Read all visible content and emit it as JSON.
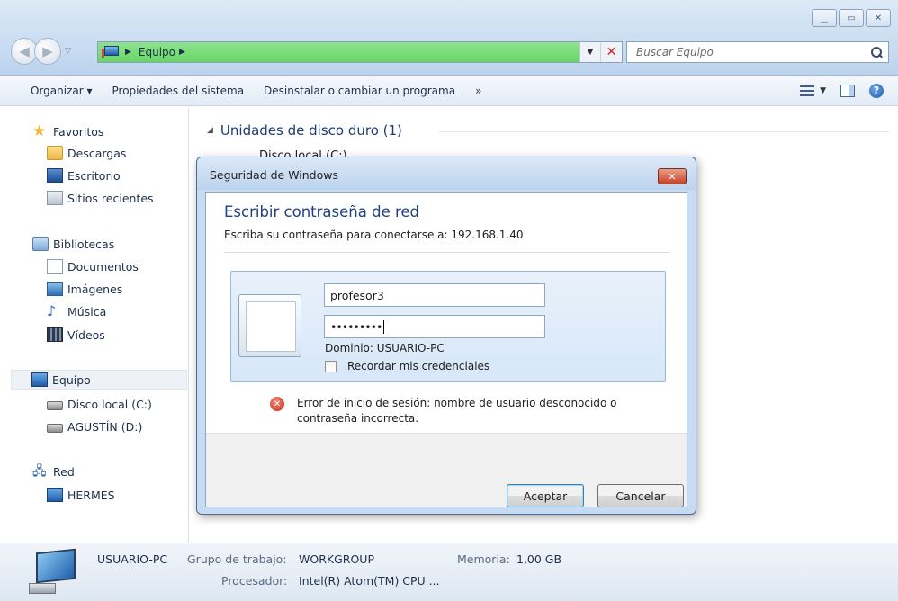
{
  "window": {
    "buttons": [
      "minimize",
      "maximize",
      "close"
    ]
  },
  "address": {
    "location": "Equipo",
    "search_placeholder": "Buscar Equipo"
  },
  "toolbar": {
    "organize": "Organizar ▾",
    "system_props": "Propiedades del sistema",
    "uninstall": "Desinstalar o cambiar un programa",
    "more": "»"
  },
  "sidebar": {
    "favorites": "Favoritos",
    "downloads": "Descargas",
    "desktop": "Escritorio",
    "recent": "Sitios recientes",
    "libraries": "Bibliotecas",
    "documents": "Documentos",
    "images": "Imágenes",
    "music": "Música",
    "videos": "Vídeos",
    "computer": "Equipo",
    "disk_c": "Disco local (C:)",
    "disk_d": "AGUSTÍN (D:)",
    "network": "Red",
    "hermes": "HERMES"
  },
  "content": {
    "group_header": "Unidades de disco duro (1)",
    "partial_item": "Disco local (C:)"
  },
  "details": {
    "pc_name": "USUARIO-PC",
    "workgroup_label": "Grupo de trabajo:",
    "workgroup_value": "WORKGROUP",
    "memory_label": "Memoria:",
    "memory_value": "1,00 GB",
    "processor_label": "Procesador:",
    "processor_value": "Intel(R) Atom(TM) CPU ..."
  },
  "dialog": {
    "title": "Seguridad de Windows",
    "heading": "Escribir contraseña de red",
    "subtitle": "Escriba su contraseña para conectarse a: 192.168.1.40",
    "username": "profesor3",
    "password_mask": "•••••••••",
    "domain": "Dominio: USUARIO-PC",
    "remember": "Recordar mis credenciales",
    "remember_checked": false,
    "error_line1": "Error de inicio de sesión: nombre de usuario desconocido o",
    "error_line2": "contraseña incorrecta.",
    "ok_label": "Aceptar",
    "cancel_label": "Cancelar"
  },
  "colors": {
    "address_bar": "#67d667",
    "dialog_heading": "#1f3f86",
    "error": "#c6301e"
  }
}
